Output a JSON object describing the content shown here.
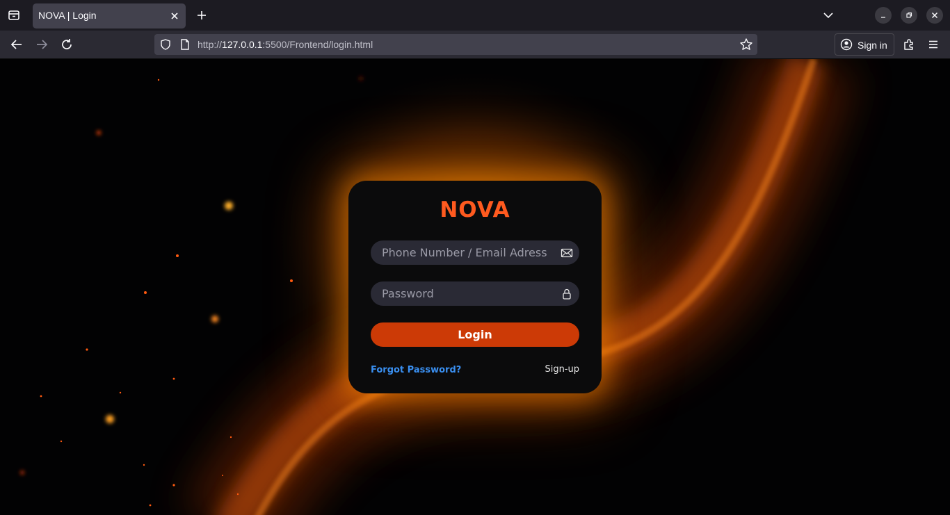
{
  "browser": {
    "tab_title": "NOVA | Login",
    "url_scheme": "http://",
    "url_host": "127.0.0.1",
    "url_rest": ":5500/Frontend/login.html",
    "sign_in_label": "Sign in"
  },
  "login": {
    "brand": "NOVA",
    "identifier_placeholder": "Phone Number / Email Adress",
    "password_placeholder": "Password",
    "login_label": "Login",
    "forgot_label": "Forgot Password?",
    "signup_label": "Sign-up"
  },
  "colors": {
    "brand": "#ff5a1f",
    "button": "#cc3a06",
    "link": "#3a8ff0",
    "glow": "#ff8c00"
  },
  "icons": {
    "identifier": "envelope-icon",
    "password": "lock-icon"
  }
}
